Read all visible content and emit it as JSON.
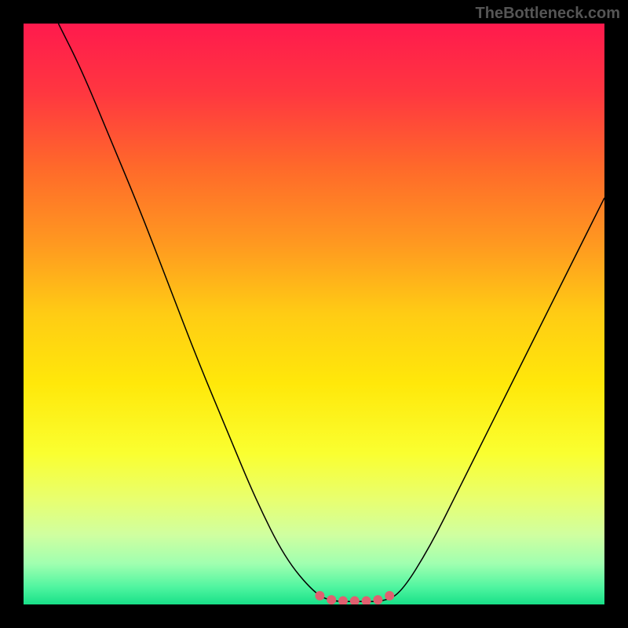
{
  "watermark": "TheBottleneck.com",
  "chart_data": {
    "type": "line",
    "title": "",
    "xlabel": "",
    "ylabel": "",
    "xlim": [
      0,
      100
    ],
    "ylim": [
      0,
      100
    ],
    "grid": false,
    "legend": false,
    "background": {
      "type": "vertical-gradient",
      "stops": [
        {
          "offset": 0.0,
          "color": "#ff1a4d"
        },
        {
          "offset": 0.12,
          "color": "#ff3740"
        },
        {
          "offset": 0.25,
          "color": "#ff6a2a"
        },
        {
          "offset": 0.38,
          "color": "#ff9920"
        },
        {
          "offset": 0.5,
          "color": "#ffcc14"
        },
        {
          "offset": 0.62,
          "color": "#ffe80a"
        },
        {
          "offset": 0.74,
          "color": "#faff30"
        },
        {
          "offset": 0.82,
          "color": "#e8ff70"
        },
        {
          "offset": 0.88,
          "color": "#d0ffa0"
        },
        {
          "offset": 0.93,
          "color": "#a0ffb0"
        },
        {
          "offset": 0.97,
          "color": "#50f5a0"
        },
        {
          "offset": 1.0,
          "color": "#18e088"
        }
      ]
    },
    "series": [
      {
        "name": "bottleneck-curve",
        "stroke": "#000000",
        "stroke_width": 1.5,
        "points": [
          {
            "x": 6,
            "y": 100
          },
          {
            "x": 10,
            "y": 92
          },
          {
            "x": 15,
            "y": 80
          },
          {
            "x": 20,
            "y": 68
          },
          {
            "x": 25,
            "y": 55
          },
          {
            "x": 30,
            "y": 42
          },
          {
            "x": 35,
            "y": 30
          },
          {
            "x": 40,
            "y": 18
          },
          {
            "x": 45,
            "y": 8
          },
          {
            "x": 50,
            "y": 2
          },
          {
            "x": 53,
            "y": 0.5
          },
          {
            "x": 58,
            "y": 0.5
          },
          {
            "x": 62,
            "y": 0.5
          },
          {
            "x": 65,
            "y": 2
          },
          {
            "x": 70,
            "y": 10
          },
          {
            "x": 75,
            "y": 20
          },
          {
            "x": 80,
            "y": 30
          },
          {
            "x": 85,
            "y": 40
          },
          {
            "x": 90,
            "y": 50
          },
          {
            "x": 95,
            "y": 60
          },
          {
            "x": 100,
            "y": 70
          }
        ]
      },
      {
        "name": "highlight-dots",
        "type": "scatter",
        "stroke": "#e06070",
        "stroke_width": 6,
        "points": [
          {
            "x": 51,
            "y": 1.5
          },
          {
            "x": 53,
            "y": 0.8
          },
          {
            "x": 55,
            "y": 0.6
          },
          {
            "x": 57,
            "y": 0.6
          },
          {
            "x": 59,
            "y": 0.6
          },
          {
            "x": 61,
            "y": 0.8
          },
          {
            "x": 63,
            "y": 1.5
          }
        ]
      }
    ]
  }
}
